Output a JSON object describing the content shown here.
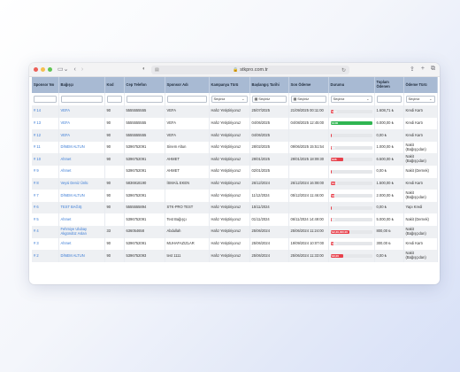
{
  "browser": {
    "url": "stkpro.com.tr",
    "traffic_lights": [
      "#ec5f57",
      "#f5bf4f",
      "#61c554"
    ]
  },
  "table": {
    "columns": [
      "Sponsor No",
      "Bağışçı",
      "Kod",
      "Cep Telefon",
      "Sponsor Adı",
      "Kampanya Türü",
      "Başlangıç Tarihi",
      "Son Ödeme",
      "Durumu",
      "Toplam Ödenen",
      "Ödeme Türü"
    ],
    "filters": {
      "kampanya_turu": "Seçiniz",
      "baslangic_tarihi": "Seçiniz",
      "son_odeme": "Seçiniz",
      "durumu": "Seçiniz",
      "odeme_turu": "Seçiniz"
    },
    "rows": [
      {
        "no": "# 14",
        "donor": "VEFA",
        "code": "90",
        "phone": "5555555555",
        "sponsor": "VEFA",
        "campaign": "Hafız Yetiştiriyoruz",
        "start": "25/07/2025",
        "last": "21/09/2025 00:11:00",
        "progress": 0.08,
        "color": "#e8414c",
        "bar_text": "%10",
        "total": "1.608,71 ₺",
        "pay": "Kredi Kartı"
      },
      {
        "no": "# 13",
        "donor": "VEFA",
        "code": "90",
        "phone": "5555555555",
        "sponsor": "VEFA",
        "campaign": "Hafız Yetiştiriyoruz",
        "start": "04/06/2025",
        "last": "04/08/2025 12:45:00",
        "progress": 1.0,
        "color": "#2fb551",
        "bar_text": "%100",
        "total": "6.000,00 ₺",
        "pay": "Kredi Kartı"
      },
      {
        "no": "# 12",
        "donor": "VEFA",
        "code": "90",
        "phone": "5555555555",
        "sponsor": "VEFA",
        "campaign": "Hafız Yetiştiriyoruz",
        "start": "04/06/2025",
        "last": "",
        "progress": 0,
        "color": "#e8414c",
        "bar_text": "",
        "total": "0,00 ₺",
        "pay": "Kredi Kartı"
      },
      {
        "no": "# 11",
        "donor": "DİNEM ALTUN",
        "code": "90",
        "phone": "5396752091",
        "sponsor": "Sinem Altun",
        "campaign": "Hafız Yetiştiriyoruz",
        "start": "28/02/2025",
        "last": "09/06/2025 15:51:54",
        "progress": 0.04,
        "color": "#e8414c",
        "bar_text": "%5",
        "total": "1.000,00 ₺",
        "pay": "Nakit (Bağışçıdan)"
      },
      {
        "no": "# 10",
        "donor": "Ahmet",
        "code": "90",
        "phone": "5396752091",
        "sponsor": "AHMET",
        "campaign": "Hafız Yetiştiriyoruz",
        "start": "29/01/2025",
        "last": "29/01/2025 18:09:30",
        "progress": 0.3,
        "color": "#e8414c",
        "bar_text": "%36",
        "total": "6.500,00 ₺",
        "pay": "Nakit (Bağışçıdan)"
      },
      {
        "no": "# 9",
        "donor": "Ahmet",
        "code": "",
        "phone": "5396752091",
        "sponsor": "AHMET",
        "campaign": "Hafız Yetiştiriyoruz",
        "start": "02/01/2025",
        "last": "",
        "progress": 0,
        "color": "#e8414c",
        "bar_text": "",
        "total": "0,00 ₺",
        "pay": "Nakit (Dernek)"
      },
      {
        "no": "# 8",
        "donor": "Veysi Deniz Ünlü",
        "code": "90",
        "phone": "5836918190",
        "sponsor": "İSMAİL EKEN",
        "campaign": "Hafız Yetiştiriyoruz",
        "start": "26/12/2024",
        "last": "26/12/2024 16:08:00",
        "progress": 0.12,
        "color": "#e8414c",
        "bar_text": "%13",
        "total": "1.500,00 ₺",
        "pay": "Kredi Kartı"
      },
      {
        "no": "# 7",
        "donor": "DİNEM ALTUN",
        "code": "90",
        "phone": "5396752091",
        "sponsor": "",
        "campaign": "Hafız Yetiştiriyoruz",
        "start": "11/12/2024",
        "last": "05/12/2024 11:46:00",
        "progress": 0.1,
        "color": "#e8414c",
        "bar_text": "%8",
        "total": "2.000,00 ₺",
        "pay": "Nakit (Bağışçıdan)"
      },
      {
        "no": "# 6",
        "donor": "TEST BAĞIŞ",
        "code": "90",
        "phone": "5555555894",
        "sponsor": "STK-PRO TEST",
        "campaign": "Hafız Yetiştiriyoruz",
        "start": "15/11/2024",
        "last": "",
        "progress": 0,
        "color": "#e8414c",
        "bar_text": "",
        "total": "0,00 ₺",
        "pay": "Yapı Kredi"
      },
      {
        "no": "# 5",
        "donor": "Ahmet",
        "code": "",
        "phone": "5396752091",
        "sponsor": "Test Bağışçı",
        "campaign": "Hafız Yetiştiriyoruz",
        "start": "01/11/2024",
        "last": "06/11/2024 14:49:00",
        "progress": 0.04,
        "color": "#e8414c",
        "bar_text": "%3",
        "total": "5.000,00 ₺",
        "pay": "Nakit (Dernek)"
      },
      {
        "no": "# 4",
        "donor": "Fehmiye Ulubay Akgündüz Aslan",
        "code": "33",
        "phone": "636054658",
        "sponsor": "Abdullah",
        "campaign": "Hafız Yetiştiriyoruz",
        "start": "25/06/2024",
        "last": "25/06/2024 11:24:00",
        "progress": 0.45,
        "color": "#e8414c",
        "bar_text": "%2,30,000.00",
        "total": "800,00 ₺",
        "pay": "Nakit (Bağışçıdan)"
      },
      {
        "no": "# 3",
        "donor": "Ahmet",
        "code": "90",
        "phone": "5396752091",
        "sponsor": "MUHAFAZIZLAR",
        "campaign": "Hafız Yetiştiriyoruz",
        "start": "25/06/2024",
        "last": "19/09/2024 10:07:00",
        "progress": 0.08,
        "color": "#e8414c",
        "bar_text": "%10",
        "total": "300,00 ₺",
        "pay": "Kredi Kartı"
      },
      {
        "no": "# 2",
        "donor": "DİNEM ALTUN",
        "code": "90",
        "phone": "5396752093",
        "sponsor": "test 1111",
        "campaign": "Hafız Yetiştiriyoruz",
        "start": "25/06/2024",
        "last": "25/06/2024 11:33:00",
        "progress": 0.3,
        "color": "#e8414c",
        "bar_text": "%0,00",
        "total": "0,00 ₺",
        "pay": "Nakit (Bağışçıdan)"
      }
    ]
  }
}
